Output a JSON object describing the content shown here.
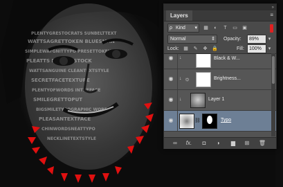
{
  "panel": {
    "tab_label": "Layers",
    "menu_icon": "panel-menu-icon",
    "filter": {
      "kind_label": "Kind",
      "search_symbol": "ρ"
    },
    "blend_mode": "Normal",
    "opacity_label": "Opacity:",
    "opacity_value": "89%",
    "lock_label": "Lock:",
    "fill_label": "Fill:",
    "fill_value": "100%",
    "layers": [
      {
        "name": "Black & W...",
        "visible": true,
        "clipped": true,
        "kind": "adjustment",
        "icon": "half-circle-icon",
        "selected": false
      },
      {
        "name": "Brightness...",
        "visible": true,
        "clipped": true,
        "kind": "adjustment",
        "icon": "sun-icon",
        "selected": false
      },
      {
        "name": "Layer 1",
        "visible": true,
        "clipped": true,
        "kind": "pixel",
        "icon": "",
        "selected": false
      },
      {
        "name": "Typo",
        "visible": true,
        "clipped": false,
        "kind": "masked",
        "icon": "chain-link-icon",
        "selected": true
      }
    ],
    "bottom_icons": [
      "link-icon",
      "fx-icon",
      "mask-icon",
      "adjustment-icon",
      "group-folder-icon",
      "new-layer-icon",
      "trash-icon"
    ],
    "bottom_labels": [
      "∞",
      "fx.",
      "◘",
      "◑",
      "▆",
      "⊞",
      "🗑"
    ]
  },
  "colors": {
    "arrow": "#e01010",
    "selection": "#6d7f95",
    "panel_bg": "#4a4a4a"
  }
}
